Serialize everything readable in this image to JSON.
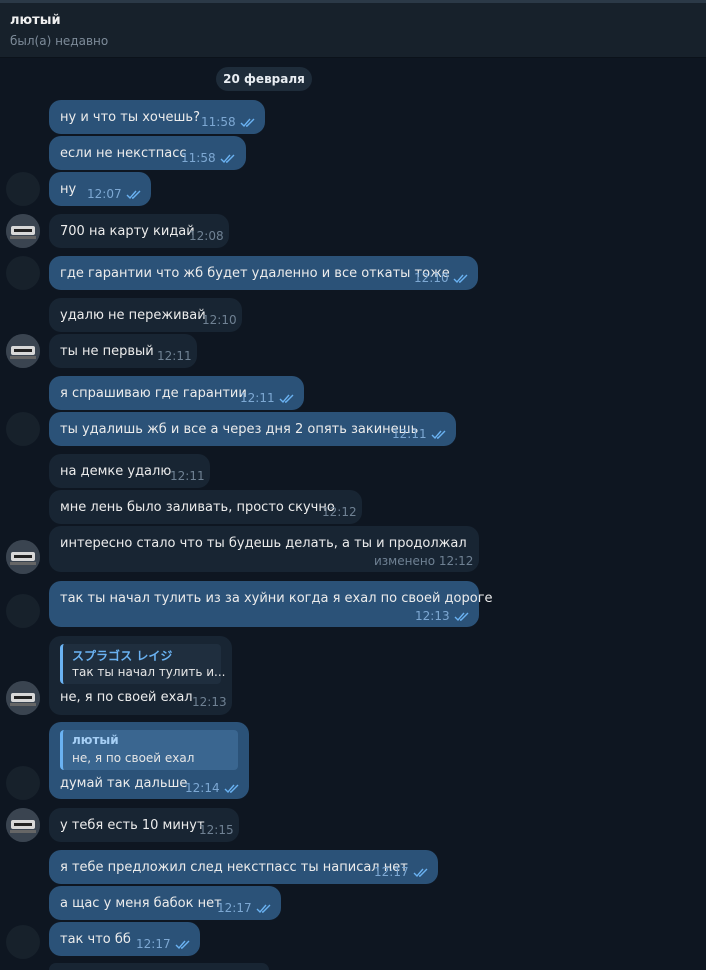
{
  "header": {
    "name": "лютый",
    "status": "был(а) недавно"
  },
  "date_label": "20 февраля",
  "messages": [
    {
      "text": "ну и что ты хочешь?",
      "time": "11:58"
    },
    {
      "text": "если не некстпасс",
      "time": "11:58"
    },
    {
      "text": "ну",
      "time": "12:07"
    },
    {
      "text": "700 на карту кидай",
      "time": "12:08"
    },
    {
      "text": "где гарантии что жб будет удаленно и все откаты тоже",
      "time": "12:10"
    },
    {
      "text": "удалю не переживай",
      "time": "12:10"
    },
    {
      "text": "ты не первый",
      "time": "12:11"
    },
    {
      "text": "я спрашиваю где гарантии",
      "time": "12:11"
    },
    {
      "text": "ты удалишь жб и все а через дня 2 опять закинешь",
      "time": "12:11"
    },
    {
      "text": "на демке удалю",
      "time": "12:11"
    },
    {
      "text": "мне лень было заливать, просто скучно",
      "time": "12:12"
    },
    {
      "text": "интересно стало что ты будешь делать, а ты и продолжал",
      "time": "изменено 12:12"
    },
    {
      "text": "так ты начал тулить из за хуйни когда я ехал по своей дороге",
      "time": "12:13"
    },
    {
      "text": "не, я по своей ехал",
      "time": "12:13",
      "reply_name": "スプラゴス レイジ",
      "reply_text": "так ты начал тулить и..."
    },
    {
      "text": "думай так дальше",
      "time": "12:14",
      "reply_name": "лютый",
      "reply_text": "не, я по своей ехал"
    },
    {
      "text": "у тебя есть 10 минут",
      "time": "12:15"
    },
    {
      "text": "я тебе предложил след некстпасс ты написал нет",
      "time": "12:17"
    },
    {
      "text": "а щас у меня бабок нет",
      "time": "12:17"
    },
    {
      "text": "так что бб",
      "time": "12:17"
    }
  ],
  "colors": {
    "background": "#0e1621",
    "incoming": "#182533",
    "outgoing": "#2b5278",
    "accent": "#6ab2f2"
  },
  "icons": {
    "read": "double-check-icon"
  }
}
